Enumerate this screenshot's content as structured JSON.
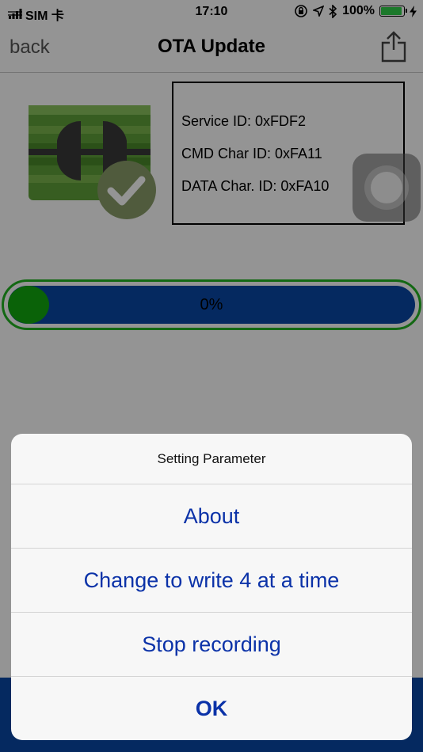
{
  "status_bar": {
    "carrier": "SIM 卡",
    "time": "17:10",
    "battery_percent": "100%",
    "battery_level": 1.0
  },
  "nav": {
    "back_label": "back",
    "title": "OTA Update"
  },
  "info": {
    "service_id": "Service ID: 0xFDF2",
    "cmd_char_id": "CMD Char ID: 0xFA11",
    "data_char_id": "DATA Char. ID: 0xFA10"
  },
  "progress": {
    "label": "0%",
    "value": 0
  },
  "action_sheet": {
    "title": "Setting Parameter",
    "items": [
      "About",
      "Change to write 4 at a time",
      "Stop recording",
      "OK"
    ]
  },
  "colors": {
    "accent_blue": "#0a47a6",
    "progress_green": "#22b422",
    "sheet_text": "#0b32a8"
  }
}
